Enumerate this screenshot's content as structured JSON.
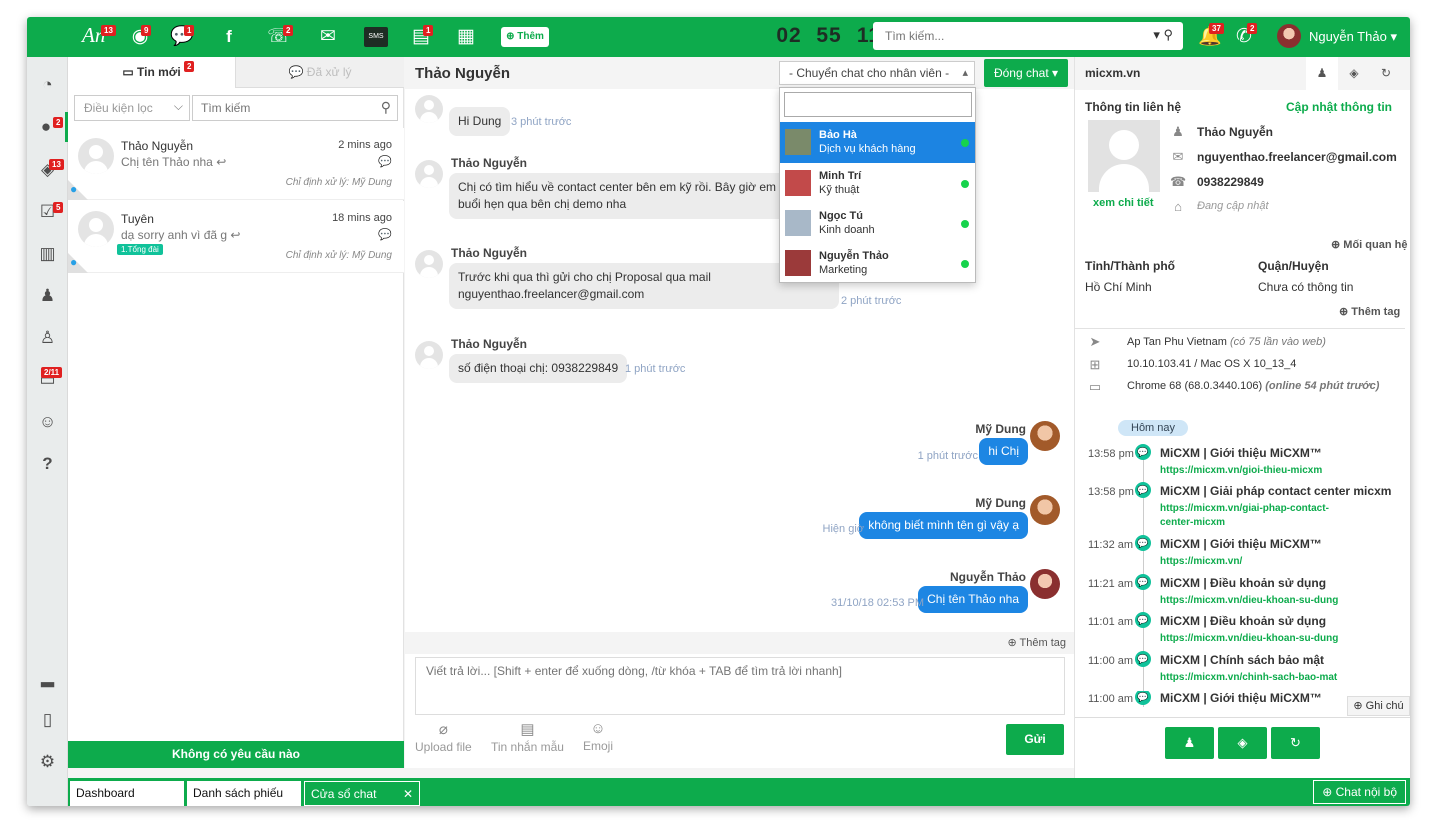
{
  "colors": {
    "brand": "#0dab4c",
    "outgoing": "#1d86e3",
    "badge": "#e02020"
  },
  "topbar": {
    "logo": "An",
    "badges": {
      "logo": "13",
      "chrome": "9",
      "chat": "1",
      "call": "2",
      "note": "1",
      "bell": "37",
      "phone": "2"
    },
    "sms": "SMS",
    "add_label": "Thêm",
    "clock": {
      "h": "02",
      "m": "55",
      "s": "11"
    },
    "search_placeholder": "Tìm kiếm...",
    "user_name": "Nguyễn Thảo"
  },
  "sidenav": {
    "badges": {
      "chat": "2",
      "ticket": "13",
      "task": "5",
      "monitor": "2/11"
    }
  },
  "conversations": {
    "tab_new": "Tin mới",
    "tab_new_badge": "2",
    "tab_done": "Đã xử lý",
    "filter_placeholder": "Điều kiện lọc",
    "search_placeholder": "Tìm kiếm",
    "items": [
      {
        "name": "Thảo Nguyễn",
        "time": "2 mins ago",
        "msg": "Chị tên Thảo nha",
        "assign": "Chỉ định xử lý: Mỹ Dung",
        "tag": ""
      },
      {
        "name": "Tuyên",
        "time": "18 mins ago",
        "msg": "dạ sorry anh vì đã g",
        "assign": "Chỉ định xử lý: Mỹ Dung",
        "tag": "1.Tổng đài"
      }
    ],
    "no_request": "Không có yêu cầu nào"
  },
  "chat": {
    "title": "Thảo Nguyễn",
    "transfer_placeholder": "- Chuyển chat cho nhân viên -",
    "close_label": "Đóng chat",
    "messages": [
      {
        "name": "Thảo Nguyễn",
        "text": "Hi Dung",
        "time": "3 phút trước"
      },
      {
        "name": "Thảo Nguyễn",
        "text": "Chị có tìm hiểu về contact center bên em kỹ rồi. Bây giờ em sắp",
        "text2": "buổi hẹn qua bên chị demo nha",
        "time": ""
      },
      {
        "name": "Thảo Nguyễn",
        "text": "Trước khi qua thì gửi cho chị Proposal qua mail",
        "text2": "nguyenthao.freelancer@gmail.com",
        "time": "2 phút trước"
      },
      {
        "name": "Thảo Nguyễn",
        "text": "số điện thoại chị: 0938229849",
        "time": "1 phút trước"
      }
    ],
    "outgoing": [
      {
        "name": "Mỹ Dung",
        "text": "hi Chị",
        "time": "1 phút trước"
      },
      {
        "name": "Mỹ Dung",
        "text": "không biết mình tên gì vậy ạ",
        "time": "Hiện giờ"
      },
      {
        "name": "Nguyễn Thảo",
        "text": "Chị tên Thảo nha",
        "time": "31/10/18 02:53 PM"
      }
    ],
    "agents": [
      {
        "name": "Bảo Hà",
        "role": "Dịch vụ khách hàng"
      },
      {
        "name": "Minh Trí",
        "role": "Kỹ thuật"
      },
      {
        "name": "Ngọc Tú",
        "role": "Kinh doanh"
      },
      {
        "name": "Nguyễn Thảo",
        "role": "Marketing"
      }
    ],
    "add_tag": "Thêm tag",
    "reply_placeholder": "Viết trả lời... [Shift + enter để xuống dòng, /từ khóa + TAB để tìm trả lời nhanh]",
    "tools": {
      "upload": "Upload file",
      "template": "Tin nhắn mẫu",
      "emoji": "Emoji"
    },
    "send": "Gửi"
  },
  "info": {
    "site": "micxm.vn",
    "contact_title": "Thông tin liên hệ",
    "update": "Cập nhật thông tin",
    "name": "Thảo Nguyễn",
    "email": "nguyenthao.freelancer@gmail.com",
    "phone": "0938229849",
    "address": "Đang cập nhật",
    "detail": "xem chi tiết",
    "relation": "Mối quan hệ",
    "city_label": "Tỉnh/Thành phố",
    "city": "Hồ Chí Minh",
    "district_label": "Quận/Huyện",
    "district": "Chưa có thông tin",
    "add_tag": "Thêm tag",
    "location": "Ap Tan Phu Vietnam",
    "location_note": "(có 75 lần vào web)",
    "ip": "10.10.103.41 / Mac OS X 10_13_4",
    "browser": "Chrome 68 (68.0.3440.106)",
    "browser_note": "(online 54 phút trước)",
    "today": "Hôm nay",
    "history": [
      {
        "time": "13:58 pm",
        "title": "MiCXM | Giới thiệu MiCXM™",
        "url": "https://micxm.vn/gioi-thieu-micxm"
      },
      {
        "time": "13:58 pm",
        "title": "MiCXM | Giải pháp contact center micxm",
        "url": "https://micxm.vn/giai-phap-contact-center-micxm"
      },
      {
        "time": "11:32 am",
        "title": "MiCXM | Giới thiệu MiCXM™",
        "url": "https://micxm.vn/"
      },
      {
        "time": "11:21 am",
        "title": "MiCXM | Điều khoản sử dụng",
        "url": "https://micxm.vn/dieu-khoan-su-dung"
      },
      {
        "time": "11:01 am",
        "title": "MiCXM | Điều khoản sử dụng",
        "url": "https://micxm.vn/dieu-khoan-su-dung"
      },
      {
        "time": "11:00 am",
        "title": "MiCXM | Chính sách bảo mật",
        "url": "https://micxm.vn/chinh-sach-bao-mat"
      },
      {
        "time": "11:00 am",
        "title": "MiCXM | Giới thiệu MiCXM™",
        "url": "https://micxm.vn/"
      }
    ],
    "note": "Ghi chú"
  },
  "bottom": {
    "tabs": [
      "Dashboard",
      "Danh sách phiếu",
      "Cửa sổ chat"
    ],
    "chat_internal": "Chat nội bộ"
  }
}
